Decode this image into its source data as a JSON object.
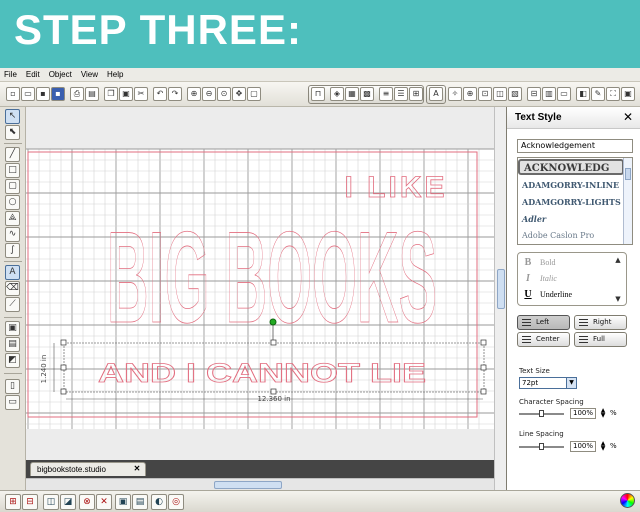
{
  "banner": {
    "title": "STEP THREE:"
  },
  "menu": [
    "File",
    "Edit",
    "Object",
    "View",
    "Help"
  ],
  "design": {
    "text_top": "I LIKE",
    "text_main": "BIG BOOKS",
    "text_bottom": "AND I CANNOT LIE",
    "height_dim": "1.240 in",
    "width_dim": "12.360 in",
    "outline_color": "#e26d7f",
    "handle_color": "#22aa22"
  },
  "file_tab": {
    "name": "bigbookstote.studio",
    "close": "✕"
  },
  "text_style_panel": {
    "title": "Text Style",
    "close": "✕",
    "font_name_value": "Acknowledgement",
    "fonts": [
      "ACKNOWLEDG",
      "ADAMGORRY-INLINE",
      "ADAMGORRY-LIGHTS",
      "Adler",
      "Adobe Caslon Pro"
    ],
    "styles": [
      {
        "glyph": "B",
        "label": "Bold"
      },
      {
        "glyph": "I",
        "label": "Italic"
      },
      {
        "glyph": "U",
        "label": "Underline"
      }
    ],
    "align": {
      "left": "Left",
      "right": "Right",
      "center": "Center",
      "full": "Full"
    },
    "text_size_label": "Text Size",
    "text_size_value": "72pt",
    "char_spacing_label": "Character Spacing",
    "char_spacing_value": "100%",
    "line_spacing_label": "Line Spacing",
    "line_spacing_value": "100%",
    "percent": "%"
  }
}
